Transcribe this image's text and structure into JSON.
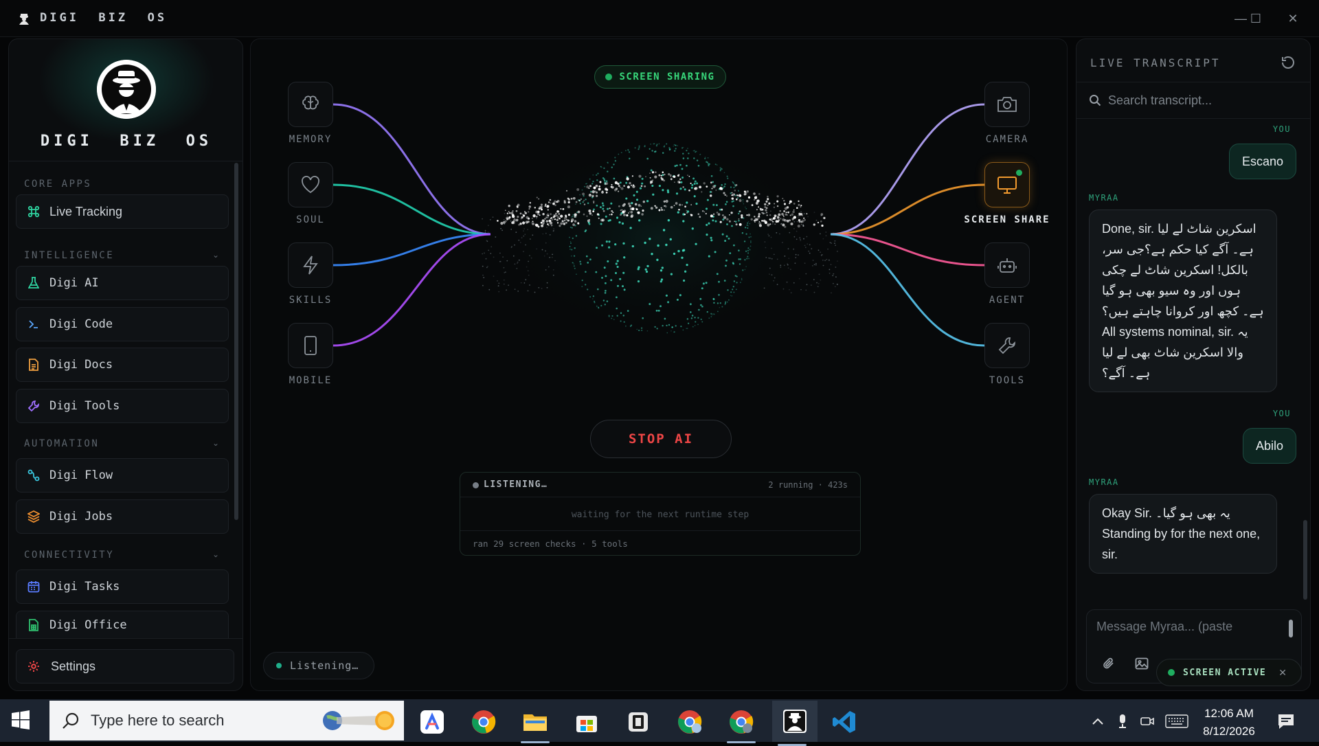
{
  "window": {
    "title": "DIGI  BIZ  OS",
    "controls": {
      "minimize": "—",
      "maximize": "☐",
      "close": "✕"
    }
  },
  "sidebar": {
    "brand_name": "DIGI  BIZ  OS",
    "sections": [
      {
        "label": "CORE APPS"
      },
      {
        "label": "INTELLIGENCE"
      },
      {
        "label": "AUTOMATION"
      },
      {
        "label": "CONNECTIVITY"
      }
    ],
    "items": [
      {
        "label": "Live Tracking",
        "icon": "command-icon",
        "color": "#2fd3a0"
      },
      {
        "label": "Digi AI",
        "icon": "flask-icon",
        "color": "#2fd3a0"
      },
      {
        "label": "Digi Code",
        "icon": "terminal-icon",
        "color": "#5aa8ff"
      },
      {
        "label": "Digi Docs",
        "icon": "document-icon",
        "color": "#f0a040"
      },
      {
        "label": "Digi Tools",
        "icon": "wrench-icon",
        "color": "#a070ff"
      },
      {
        "label": "Digi Flow",
        "icon": "workflow-icon",
        "color": "#3ac8e0"
      },
      {
        "label": "Digi Jobs",
        "icon": "layers-icon",
        "color": "#f09030"
      },
      {
        "label": "Digi Tasks",
        "icon": "calendar-icon",
        "color": "#5a7cff"
      },
      {
        "label": "Digi Office",
        "icon": "spreadsheet-icon",
        "color": "#30c070"
      }
    ],
    "settings_label": "Settings"
  },
  "main": {
    "badge": "SCREEN SHARING",
    "left_nodes": [
      {
        "label": "MEMORY",
        "icon": "brain-icon",
        "color": "#9a7cff"
      },
      {
        "label": "SOUL",
        "icon": "heart-icon",
        "color": "#22d3b0"
      },
      {
        "label": "SKILLS",
        "icon": "bolt-icon",
        "color": "#3a8cff"
      },
      {
        "label": "MOBILE",
        "icon": "phone-icon",
        "color": "#b050ff"
      }
    ],
    "right_nodes": [
      {
        "label": "CAMERA",
        "icon": "camera-icon",
        "color": "#b9a8ff"
      },
      {
        "label": "SCREEN SHARE",
        "icon": "monitor-icon",
        "color": "#f29a2e",
        "active": true
      },
      {
        "label": "AGENT",
        "icon": "robot-icon",
        "color": "#ff5c9a"
      },
      {
        "label": "TOOLS",
        "icon": "wrench-icon",
        "color": "#5ac8f0"
      }
    ],
    "stop_label": "STOP AI",
    "runtime": {
      "status": "LISTENING…",
      "meta": "2 running · 423s",
      "waiting": "waiting for the next runtime step",
      "footer": "ran 29 screen checks · 5 tools"
    },
    "listening_pill": "Listening…"
  },
  "transcript": {
    "title": "LIVE TRANSCRIPT",
    "search_placeholder": "Search transcript...",
    "messages": [
      {
        "who": "YOU",
        "text": "Escano"
      },
      {
        "who": "MYRAA",
        "text": "Done, sir. اسکرین شاٹ لے لیا ہے۔ آگے کیا حکم ہے؟جی سر، بالکل! اسکرین شاٹ لے چکی ہوں اور وہ سیو بھی ہو گیا ہے۔ کچھ اور کروانا چاہتے ہیں؟All systems nominal, sir. یہ والا اسکرین شاٹ بھی لے لیا ہے۔ آگے؟"
      },
      {
        "who": "YOU",
        "text": "Abilo"
      },
      {
        "who": "MYRAA",
        "text": "Okay Sir. یہ بھی ہو گیا۔ Standing by for the next one, sir."
      }
    ],
    "composer_placeholder": "Message Myraa... (paste",
    "screen_active": "SCREEN ACTIVE"
  },
  "taskbar": {
    "search_placeholder": "Type here to search",
    "time": "12:06 AM",
    "date": "8/12/2026"
  }
}
